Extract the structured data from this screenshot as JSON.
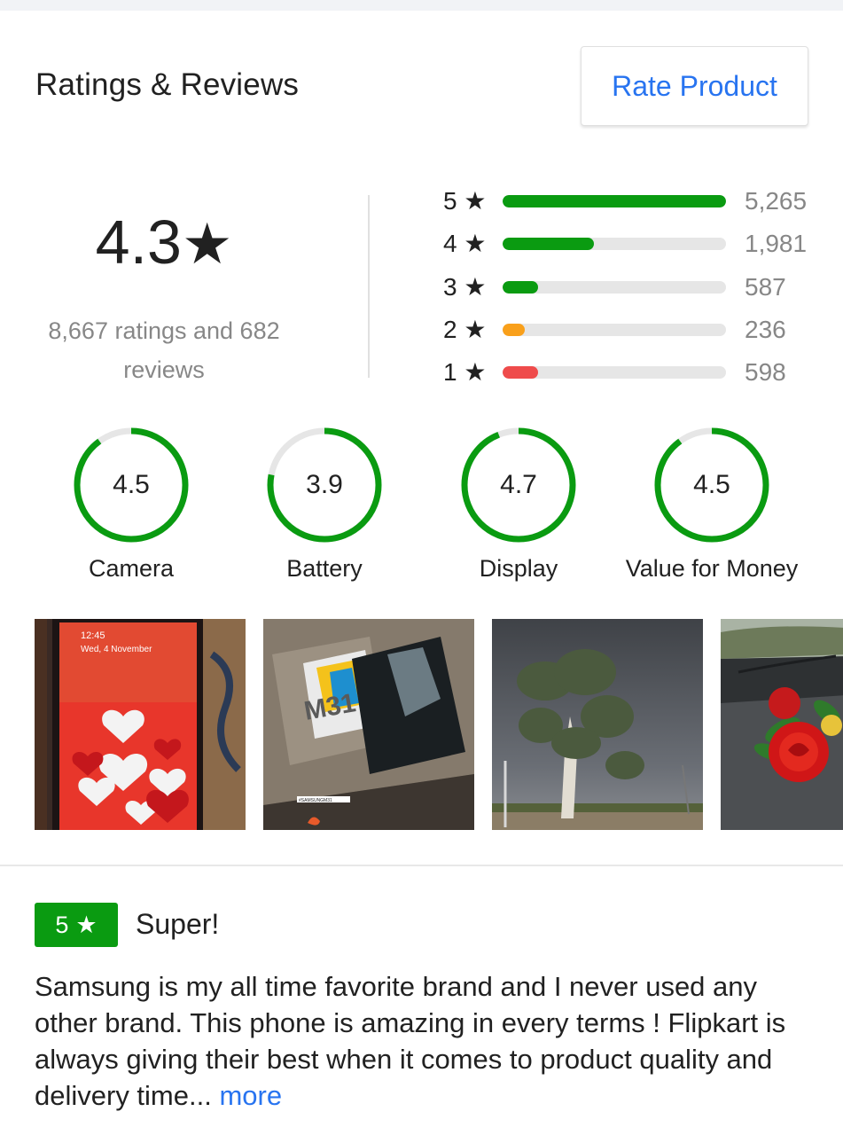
{
  "header": {
    "title": "Ratings & Reviews",
    "rate_button": "Rate Product"
  },
  "overall": {
    "value": "4.3",
    "star": "★",
    "summary_line1": "8,667 ratings and 682",
    "summary_line2": "reviews"
  },
  "distribution": [
    {
      "label": "5 ★",
      "count": "5,265",
      "fraction": 1.0,
      "color": "#0a9b11"
    },
    {
      "label": "4 ★",
      "count": "1,981",
      "fraction": 0.41,
      "color": "#0a9b11"
    },
    {
      "label": "3 ★",
      "count": "587",
      "fraction": 0.16,
      "color": "#0a9b11"
    },
    {
      "label": "2 ★",
      "count": "236",
      "fraction": 0.1,
      "color": "#f9a01b"
    },
    {
      "label": "1 ★",
      "count": "598",
      "fraction": 0.16,
      "color": "#ef4b4b"
    }
  ],
  "aspects": [
    {
      "value": "4.5",
      "label": "Camera",
      "fraction": 0.9
    },
    {
      "value": "3.9",
      "label": "Battery",
      "fraction": 0.78
    },
    {
      "value": "4.7",
      "label": "Display",
      "fraction": 0.94
    },
    {
      "value": "4.5",
      "label": "Value for Money",
      "fraction": 0.9
    }
  ],
  "photos": [
    {
      "name": "photo-phone-hearts",
      "time": "12:45",
      "date": "Wed, 4 November"
    },
    {
      "name": "photo-samsung-box",
      "box_label": "M31",
      "tag": "#SAMSUNGM31"
    },
    {
      "name": "photo-cloudy-tree"
    },
    {
      "name": "photo-rose-dashboard"
    }
  ],
  "review": {
    "rating": "5",
    "star": "★",
    "title": "Super!",
    "body": "Samsung is my all time favorite brand and I never used any other brand. This phone is amazing  in every terms ! Flipkart is always giving their best when it comes to product quality and delivery time... ",
    "more": "more"
  },
  "colors": {
    "accent_blue": "#2874f0",
    "rating_green": "#0a9b11",
    "rating_orange": "#f9a01b",
    "rating_red": "#ef4b4b"
  }
}
